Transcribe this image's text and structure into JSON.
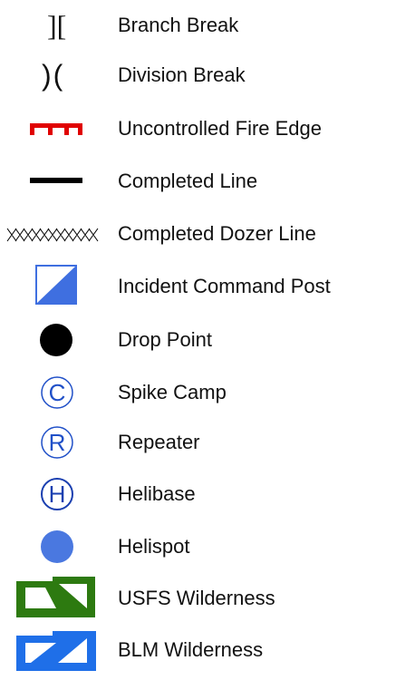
{
  "legend": {
    "items": [
      {
        "label": "Branch Break",
        "glyph": "][",
        "icon": "branch-break-icon"
      },
      {
        "label": "Division Break",
        "glyph": ")(",
        "icon": "division-break-icon"
      },
      {
        "label": "Uncontrolled Fire Edge",
        "icon": "uncontrolled-fire-edge-icon",
        "color": "#e00000"
      },
      {
        "label": "Completed Line",
        "icon": "completed-line-icon",
        "color": "#000000"
      },
      {
        "label": "Completed Dozer Line",
        "icon": "completed-dozer-line-icon",
        "color": "#000000"
      },
      {
        "label": "Incident Command Post",
        "icon": "incident-command-post-icon",
        "color": "#3f6fe0"
      },
      {
        "label": "Drop Point",
        "icon": "drop-point-icon",
        "color": "#000000"
      },
      {
        "label": "Spike Camp",
        "glyph": "C",
        "icon": "spike-camp-icon",
        "color": "#2050c8"
      },
      {
        "label": "Repeater",
        "glyph": "R",
        "icon": "repeater-icon",
        "color": "#2050c8"
      },
      {
        "label": "Helibase",
        "glyph": "H",
        "icon": "helibase-icon",
        "color": "#1a3fb0"
      },
      {
        "label": "Helispot",
        "icon": "helispot-icon",
        "color": "#4a78e0"
      },
      {
        "label": "USFS Wilderness",
        "icon": "usfs-wilderness-icon",
        "color": "#2d7a10"
      },
      {
        "label": "BLM Wilderness",
        "icon": "blm-wilderness-icon",
        "color": "#1f6fe8"
      }
    ]
  }
}
